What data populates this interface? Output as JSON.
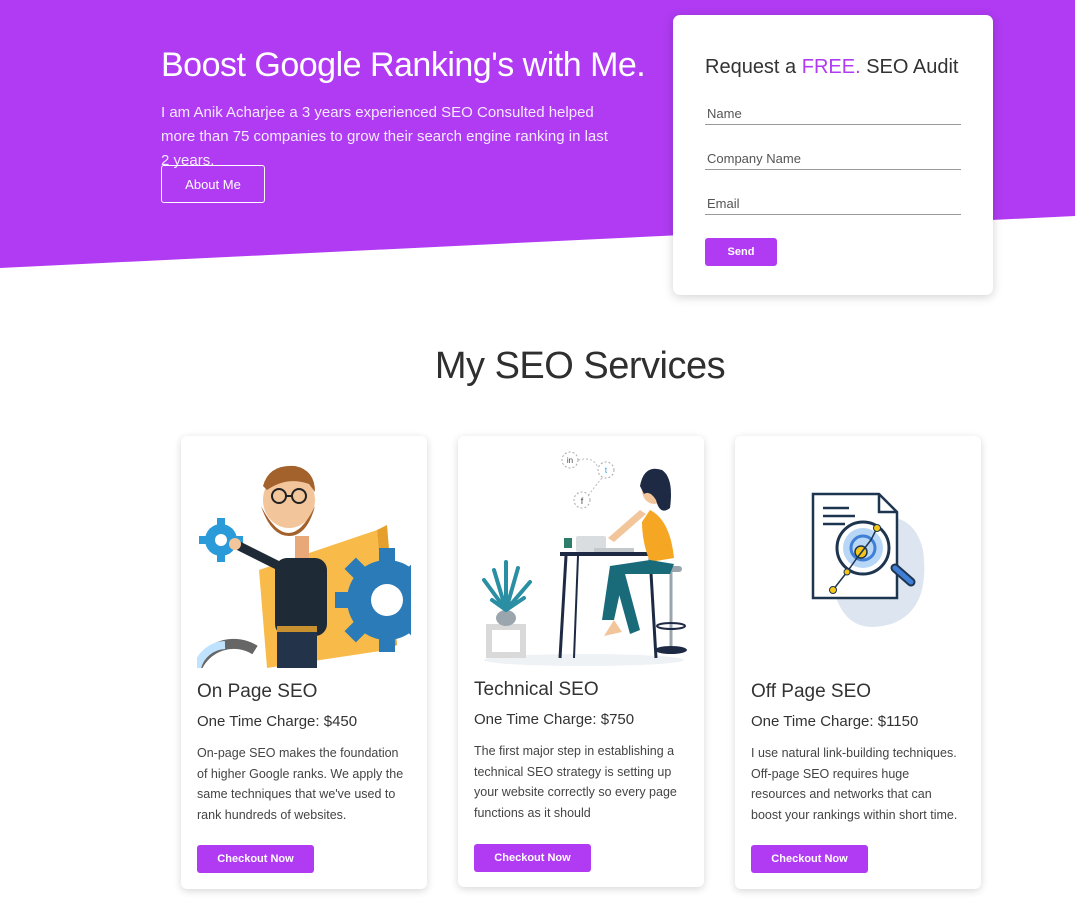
{
  "colors": {
    "accent": "#b03bf2",
    "hero_bg": "#b03bf2"
  },
  "hero": {
    "title": "Boost Google Ranking's with Me.",
    "text": "I am Anik Acharjee a 3 years experienced SEO Consulted helped more than 75 companies to grow their search engine ranking in last 2 years.",
    "about_button": "About Me"
  },
  "audit_form": {
    "title_pre": "Request a ",
    "title_accent": "FREE.",
    "title_post": " SEO Audit",
    "name_placeholder": "Name",
    "company_placeholder": "Company Name",
    "email_placeholder": "Email",
    "send_label": "Send"
  },
  "services": {
    "heading": "My SEO Services",
    "cards": [
      {
        "title": "On Page SEO",
        "price": "One Time Charge: $450",
        "description": "On-page SEO makes the foundation of higher Google ranks. We apply the same techniques that we've used to rank hundreds of websites.",
        "button": "Checkout Now",
        "illustration": "man-with-gears-illustration"
      },
      {
        "title": "Technical SEO",
        "price": "One Time Charge: $750",
        "description": "The first major step in establishing a technical SEO strategy is setting up your website correctly so every page functions as it should",
        "button": "Checkout Now",
        "illustration": "woman-at-laptop-illustration"
      },
      {
        "title": "Off Page SEO",
        "price": "One Time Charge: $1150",
        "description": "I use natural link-building techniques. Off-page SEO requires huge resources and networks that can boost your rankings within short time.",
        "button": "Checkout Now",
        "illustration": "document-search-icon"
      }
    ]
  }
}
